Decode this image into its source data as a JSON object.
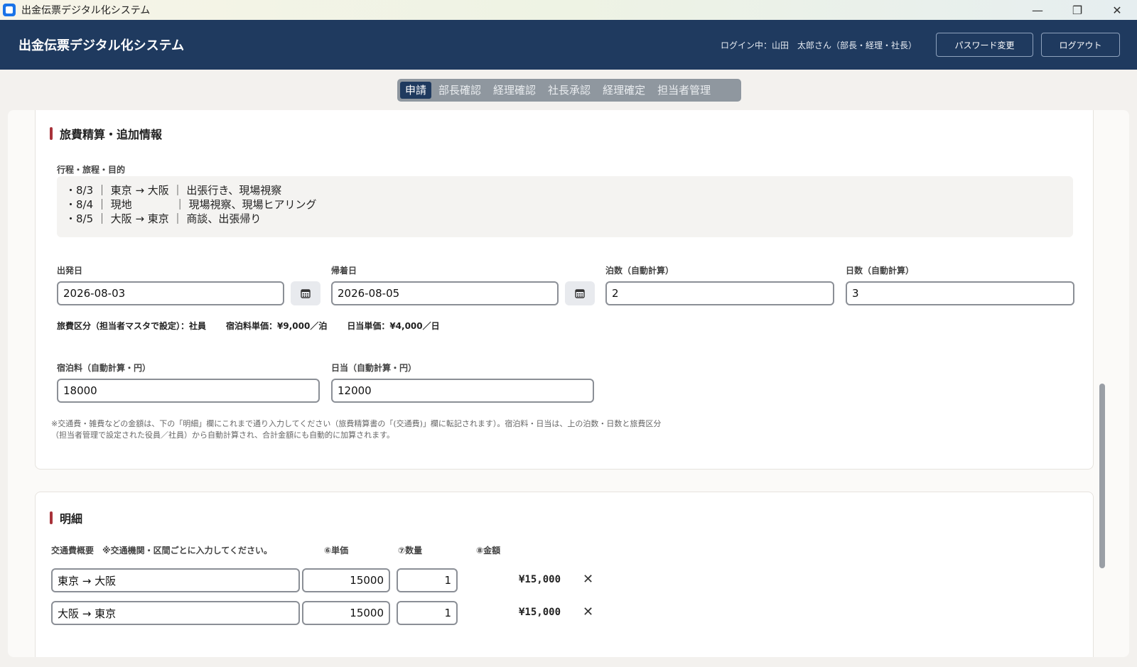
{
  "window": {
    "title": "出金伝票デジタル化システム",
    "controls": {
      "minimize": "—",
      "maximize": "❐",
      "close": "✕"
    }
  },
  "header": {
    "app_title": "出金伝票デジタル化システム",
    "login_info": "ログイン中：山田　太郎さん（部長・経理・社長）",
    "password_button": "パスワード変更",
    "logout_button": "ログアウト"
  },
  "tabs": [
    {
      "label": "申請",
      "active": true
    },
    {
      "label": "部長確認",
      "active": false
    },
    {
      "label": "経理確認",
      "active": false
    },
    {
      "label": "社長承認",
      "active": false
    },
    {
      "label": "経理確定",
      "active": false
    },
    {
      "label": "担当者管理",
      "active": false
    }
  ],
  "travel": {
    "section_title": "旅費精算・追加情報",
    "itinerary_label": "行程・旅程・目的",
    "itinerary_value": "・8/3 ｜ 東京 → 大阪 ｜ 出張行き、現場視察\n・8/4 ｜ 現地　　　　｜ 現場視察、現場ヒアリング\n・8/5 ｜ 大阪 → 東京 ｜ 商談、出張帰り",
    "departure_label": "出発日",
    "departure_value": "2026-08-03",
    "return_label": "帰着日",
    "return_value": "2026-08-05",
    "nights_label": "泊数（自動計算）",
    "nights_value": "2",
    "days_label": "日数（自動計算）",
    "days_value": "3",
    "category_text": "旅費区分（担当者マスタで設定）：社員",
    "lodging_rate_text": "宿泊料単価：¥9,000／泊",
    "daily_rate_text": "日当単価：¥4,000／日",
    "lodging_label": "宿泊料（自動計算・円）",
    "lodging_value": "18000",
    "daily_label": "日当（自動計算・円）",
    "daily_value": "12000",
    "note": "※交通費・雑費などの金額は、下の「明細」欄にこれまで通り入力してください（旅費精算書の「(交通費)」欄に転記されます）。宿泊料・日当は、上の泊数・日数と旅費区分（担当者管理で設定された役員／社員）から自動計算され、合計金額にも自動的に加算されます。"
  },
  "details": {
    "section_title": "明細",
    "col_summary": "交通費概要　※交通機関・区間ごとに入力してください。",
    "col_unit_price": "⑥単価",
    "col_qty": "⑦数量",
    "col_amount": "⑧金額",
    "rows": [
      {
        "summary": "東京 → 大阪",
        "unit_price": "15000",
        "qty": "1",
        "amount": "¥15,000",
        "delete": "✕"
      },
      {
        "summary": "大阪 → 東京",
        "unit_price": "15000",
        "qty": "1",
        "amount": "¥15,000",
        "delete": "✕"
      }
    ]
  }
}
